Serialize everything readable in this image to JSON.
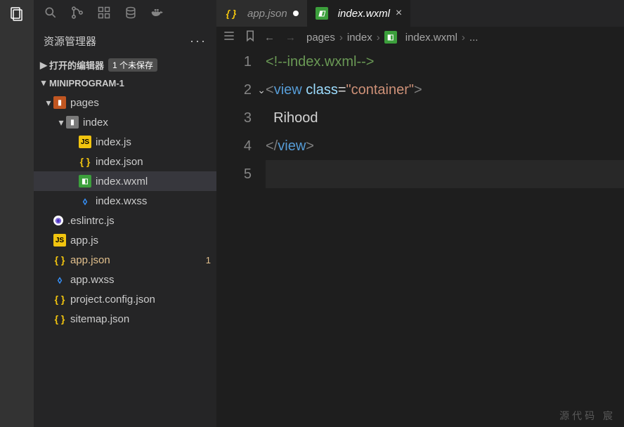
{
  "sidebar": {
    "title": "资源管理器",
    "sections": {
      "openEditors": {
        "label": "打开的编辑器",
        "badge": "1 个未保存",
        "expanded": false
      },
      "project": {
        "label": "MINIPROGRAM-1",
        "expanded": true
      }
    }
  },
  "tree": {
    "items": [
      {
        "label": "pages",
        "type": "folder-pages",
        "depth": 0,
        "expanded": true
      },
      {
        "label": "index",
        "type": "folder",
        "depth": 1,
        "expanded": true
      },
      {
        "label": "index.js",
        "type": "js",
        "depth": 2
      },
      {
        "label": "index.json",
        "type": "json",
        "depth": 2
      },
      {
        "label": "index.wxml",
        "type": "wxml",
        "depth": 2,
        "active": true
      },
      {
        "label": "index.wxss",
        "type": "wxss",
        "depth": 2
      },
      {
        "label": ".eslintrc.js",
        "type": "eslint",
        "depth": 0
      },
      {
        "label": "app.js",
        "type": "js",
        "depth": 0
      },
      {
        "label": "app.json",
        "type": "json",
        "depth": 0,
        "modified": true,
        "count": "1"
      },
      {
        "label": "app.wxss",
        "type": "wxss",
        "depth": 0
      },
      {
        "label": "project.config.json",
        "type": "json",
        "depth": 0
      },
      {
        "label": "sitemap.json",
        "type": "json",
        "depth": 0
      }
    ]
  },
  "tabs": [
    {
      "label": "app.json",
      "iconType": "json",
      "dirty": true,
      "active": false
    },
    {
      "label": "index.wxml",
      "iconType": "wxml",
      "dirty": false,
      "active": true
    }
  ],
  "breadcrumb": {
    "parts": [
      "pages",
      "index",
      "index.wxml",
      "..."
    ],
    "iconAt": 2
  },
  "editor": {
    "lines": [
      {
        "n": "1",
        "tokens": [
          [
            "comment",
            "<!--index.wxml-->"
          ]
        ]
      },
      {
        "n": "2",
        "tokens": [
          [
            "bracket",
            "<"
          ],
          [
            "tag",
            "view"
          ],
          [
            "text",
            " "
          ],
          [
            "attr",
            "class"
          ],
          [
            "text",
            "="
          ],
          [
            "string",
            "\"container\""
          ],
          [
            "bracket",
            ">"
          ]
        ]
      },
      {
        "n": "3",
        "tokens": [
          [
            "text",
            "  Rihood"
          ]
        ]
      },
      {
        "n": "4",
        "tokens": [
          [
            "bracket",
            "</"
          ],
          [
            "tag",
            "view"
          ],
          [
            "bracket",
            ">"
          ]
        ]
      },
      {
        "n": "5",
        "tokens": [],
        "current": true
      }
    ]
  },
  "watermark": "源代码  宸"
}
